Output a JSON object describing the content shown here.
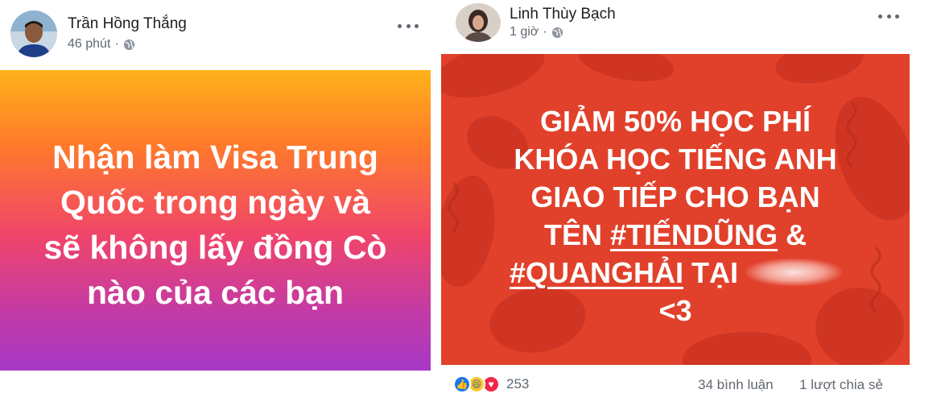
{
  "post_left": {
    "author": "Trần Hồng Thắng",
    "time": "46 phút",
    "separator": "·",
    "banner": {
      "line1": "Nhận làm Visa Trung",
      "line2": "Quốc trong ngày và",
      "line3": "sẽ không lấy đồng Cò",
      "line4": "nào của các bạn"
    }
  },
  "post_right": {
    "author": "Linh Thùy Bạch",
    "time": "1 giờ",
    "separator": "·",
    "banner": {
      "line1": "GIẢM 50% HỌC PHÍ",
      "line2": "KHÓA HỌC TIẾNG ANH",
      "line3": "GIAO TIẾP CHO BẠN",
      "line4_a": "TÊN ",
      "line4_tag": "#TIẾNDŨNG",
      "line4_b": " &",
      "line5_tag": "#QUANGHẢI",
      "line5_b": " TẠI ",
      "line6": "<3"
    },
    "footer": {
      "reaction_count": "253",
      "comments": "34 bình luận",
      "shares": "1 lượt chia sẻ"
    }
  },
  "colors": {
    "left_gradient_top": "#ffb21a",
    "left_gradient_bottom": "#a639c6",
    "right_banner_bg": "#e1412b"
  },
  "icons": [
    "globe-icon",
    "more-options-icon",
    "like-reaction-icon",
    "haha-reaction-icon",
    "love-reaction-icon"
  ]
}
